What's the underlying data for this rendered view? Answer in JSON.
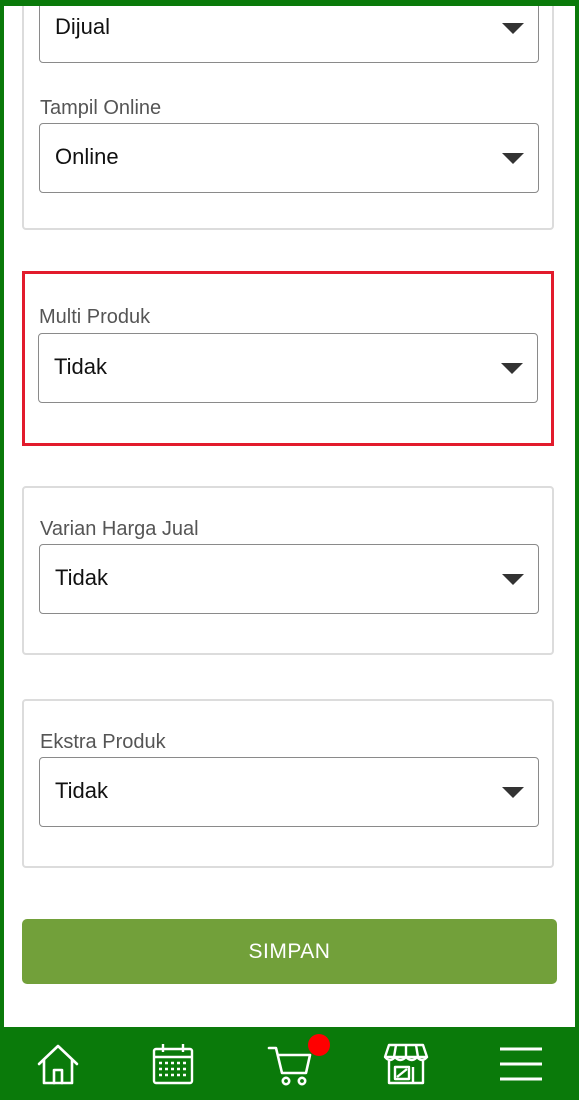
{
  "form": {
    "status_field": {
      "value": "Dijual"
    },
    "tampil_online": {
      "label": "Tampil Online",
      "value": "Online"
    },
    "multi_produk": {
      "label": "Multi Produk",
      "value": "Tidak"
    },
    "varian_harga_jual": {
      "label": "Varian Harga Jual",
      "value": "Tidak"
    },
    "ekstra_produk": {
      "label": "Ekstra Produk",
      "value": "Tidak"
    },
    "save_label": "SIMPAN"
  },
  "bottom_nav": {
    "items": [
      {
        "icon": "home-icon"
      },
      {
        "icon": "calendar-icon"
      },
      {
        "icon": "cart-icon",
        "badge": true
      },
      {
        "icon": "store-icon"
      },
      {
        "icon": "menu-icon"
      }
    ]
  },
  "colors": {
    "brand_green": "#0a7a0a",
    "button_green": "#72a03a",
    "highlight_red": "#e21b2c",
    "badge_red": "#ff0000"
  }
}
